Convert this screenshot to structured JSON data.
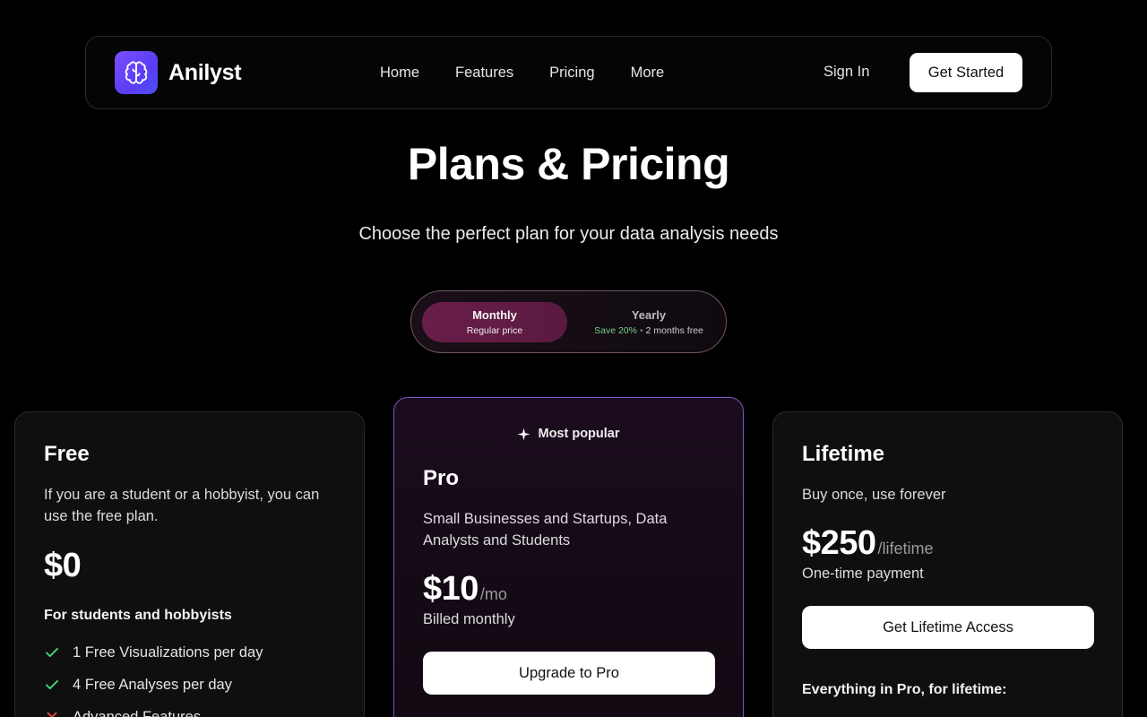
{
  "navbar": {
    "brand": "Anilyst",
    "links": [
      "Home",
      "Features",
      "Pricing",
      "More"
    ],
    "sign_in": "Sign In",
    "get_started": "Get Started"
  },
  "hero": {
    "title": "Plans & Pricing",
    "subtitle": "Choose the perfect plan for your data analysis needs"
  },
  "toggle": {
    "monthly": {
      "title": "Monthly",
      "sub": "Regular price",
      "selected": true
    },
    "yearly": {
      "title": "Yearly",
      "save": "Save 20%",
      "dot": "•",
      "free": "2 months free"
    }
  },
  "plans": {
    "free": {
      "name": "Free",
      "description": "If you are a student or a hobbyist, you can use the free plan.",
      "price": "$0",
      "section_title": "For students and hobbyists",
      "features": [
        {
          "text": "1 Free Visualizations per day",
          "status": "included"
        },
        {
          "text": "4 Free Analyses per day",
          "status": "included"
        },
        {
          "text": "Advanced Features",
          "status": "excluded"
        }
      ]
    },
    "pro": {
      "badge": "Most popular",
      "name": "Pro",
      "description": "Small Businesses and Startups, Data Analysts and Students",
      "price": "$10",
      "price_unit": "/mo",
      "billing_note": "Billed monthly",
      "cta": "Upgrade to Pro"
    },
    "lifetime": {
      "name": "Lifetime",
      "description": "Buy once, use forever",
      "price": "$250",
      "price_unit": "/lifetime",
      "billing_note": "One-time payment",
      "cta": "Get Lifetime Access",
      "section_title": "Everything in Pro, for lifetime:"
    }
  },
  "colors": {
    "accent_purple": "#6a4cf5",
    "pro_border": "#7a55c7",
    "check_green": "#4ade80",
    "cross_red": "#ef4444"
  }
}
